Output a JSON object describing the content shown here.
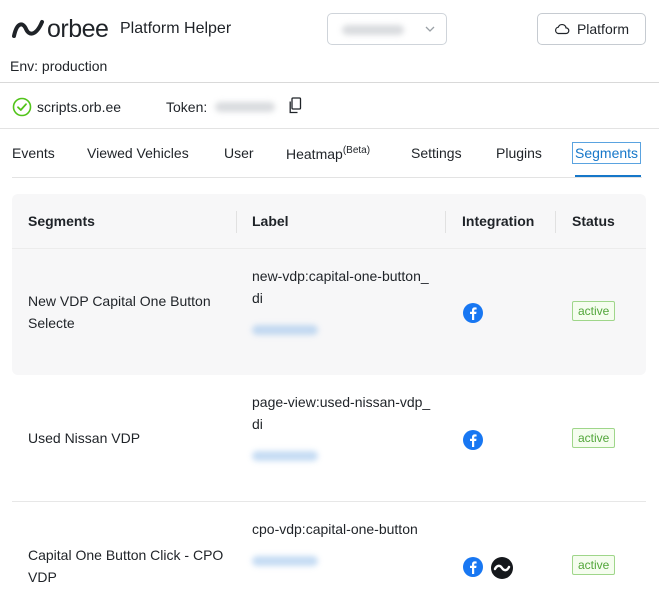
{
  "header": {
    "logo_text": "orbee",
    "app_title": "Platform Helper",
    "env_label": "Env: production",
    "platform_button": "Platform"
  },
  "status": {
    "host": "scripts.orb.ee",
    "token_label": "Token:"
  },
  "tabs": [
    {
      "label": "Events",
      "sup": ""
    },
    {
      "label": "Viewed Vehicles",
      "sup": ""
    },
    {
      "label": "User",
      "sup": ""
    },
    {
      "label": "Heatmap",
      "sup": "(Beta)"
    },
    {
      "label": "Settings",
      "sup": ""
    },
    {
      "label": "Plugins",
      "sup": ""
    },
    {
      "label": "Segments",
      "sup": "",
      "active": true
    }
  ],
  "table": {
    "columns": [
      "Segments",
      "Label",
      "Integration",
      "Status"
    ],
    "rows": [
      {
        "segment": "New VDP Capital One Button Selecte",
        "label": "new-vdp:capital-one-button_di",
        "integrations": [
          "facebook-icon"
        ],
        "status": "active"
      },
      {
        "segment": "Used Nissan VDP",
        "label": "page-view:used-nissan-vdp_di",
        "integrations": [
          "facebook-icon"
        ],
        "status": "active"
      },
      {
        "segment": "Capital One Button Click - CPO VDP",
        "label": "cpo-vdp:capital-one-button",
        "integrations": [
          "facebook-icon",
          "wave-icon"
        ],
        "status": "active"
      }
    ]
  },
  "colors": {
    "accent": "#1677c9",
    "status_green": "#52a63a",
    "facebook_blue": "#1877f2"
  }
}
